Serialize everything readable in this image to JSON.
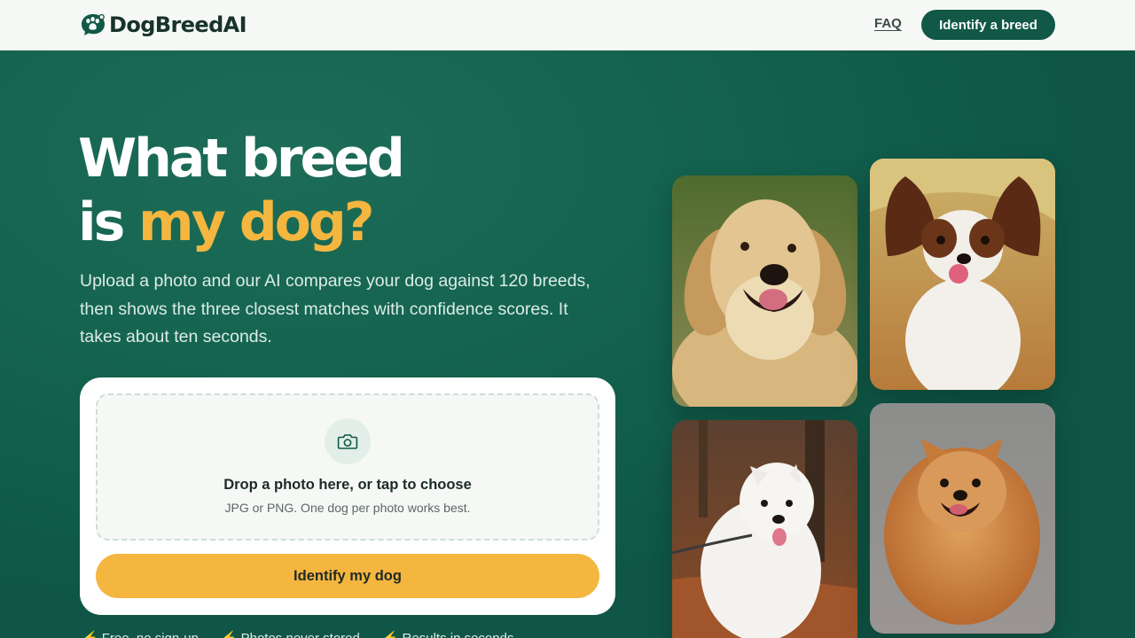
{
  "header": {
    "logo_text": "DogBreedAI",
    "logo_icon": "paw-chat-icon",
    "nav": {
      "faq_label": "FAQ",
      "cta_label": "Identify a breed"
    }
  },
  "hero": {
    "headline_line1": "What breed",
    "headline_line2_prefix": "is ",
    "headline_line2_accent": "my dog?",
    "lede": "Upload a photo and our AI compares your dog against 120 breeds, then shows the three closest matches with confidence scores. It takes about ten seconds."
  },
  "upload": {
    "icon": "camera-icon",
    "title": "Drop a photo here, or tap to choose",
    "hint": "JPG or PNG. One dog per photo works best.",
    "button_label": "Identify my dog"
  },
  "perks": [
    {
      "icon": "lightning-icon",
      "label": "Free, no sign-up"
    },
    {
      "icon": "lightning-icon",
      "label": "Photos never stored"
    },
    {
      "icon": "lightning-icon",
      "label": "Results in seconds"
    }
  ],
  "photos": [
    {
      "name": "golden-retriever-photo"
    },
    {
      "name": "papillon-photo"
    },
    {
      "name": "samoyed-photo"
    },
    {
      "name": "pomeranian-photo"
    }
  ],
  "colors": {
    "brand_green": "#115846",
    "accent_yellow": "#f4b63f",
    "header_bg": "#f6f8f6"
  }
}
